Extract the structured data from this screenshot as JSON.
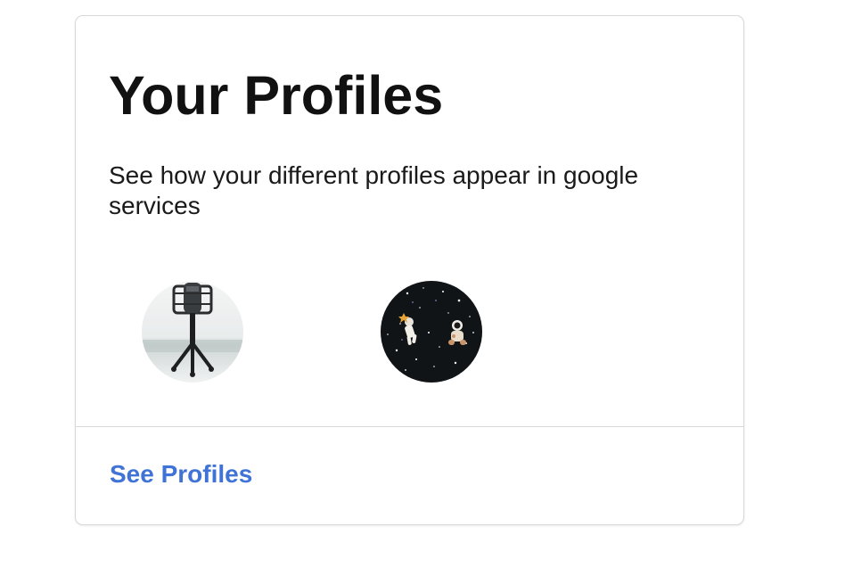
{
  "card": {
    "title": "Your Profiles",
    "description": "See how your different profiles appear in google services",
    "profiles": [
      {
        "icon": "microphone-stand-avatar"
      },
      {
        "icon": "astronauts-space-avatar"
      }
    ],
    "footer_link": "See Profiles"
  },
  "colors": {
    "link": "#3f73d6",
    "border": "#d8d8d8",
    "text": "#111111"
  }
}
